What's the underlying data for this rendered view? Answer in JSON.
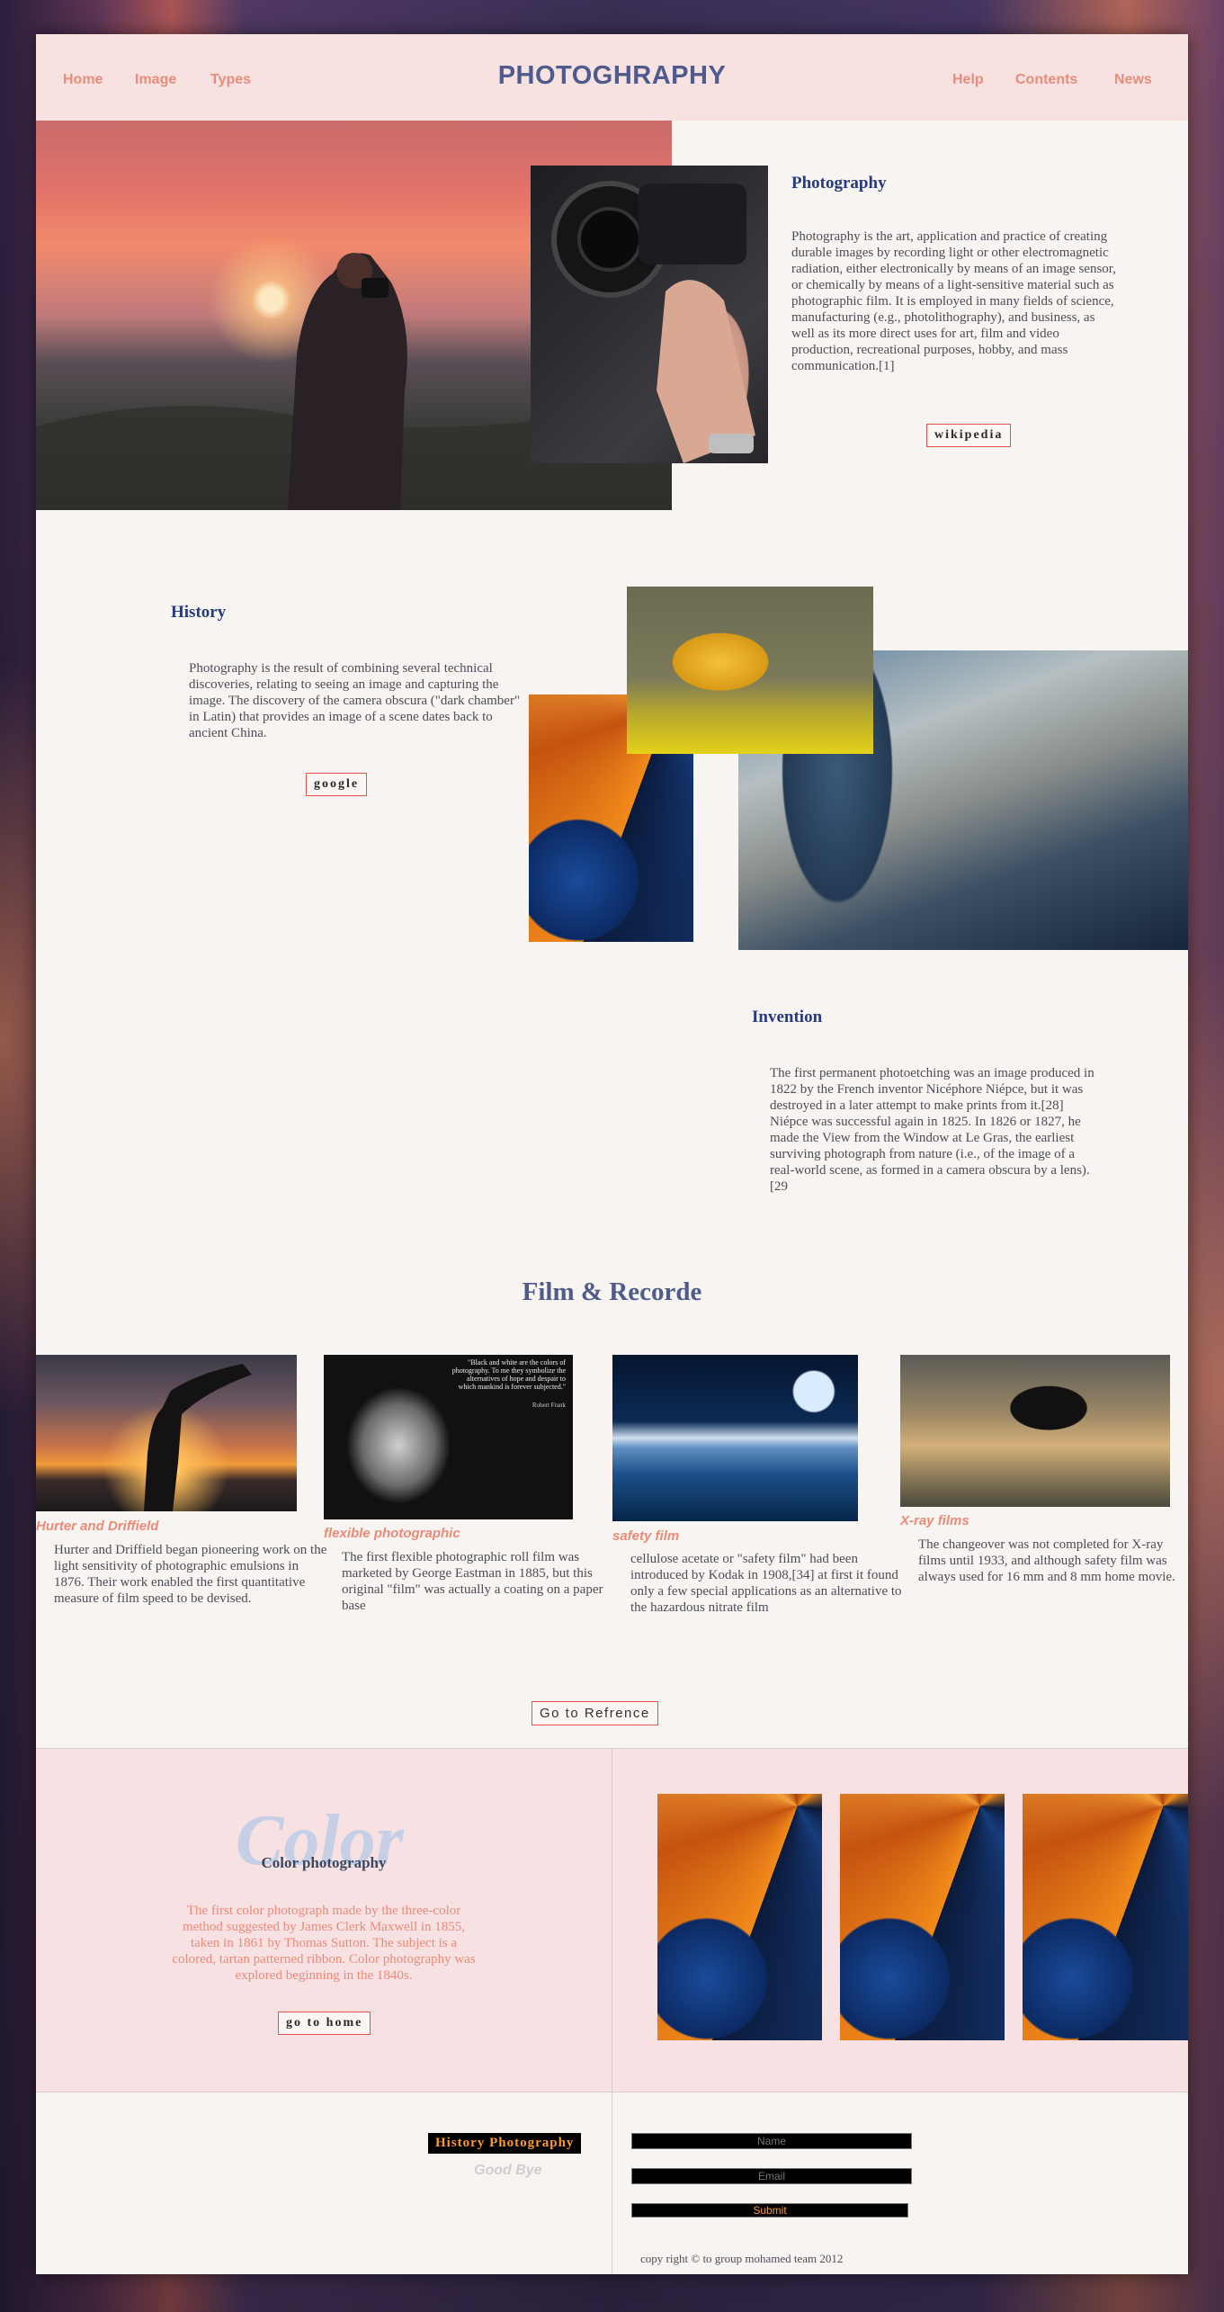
{
  "nav": {
    "left": [
      "Home",
      "Image",
      "Types"
    ],
    "brand": "PHOTOGHRAPHY",
    "right": [
      "Help",
      "Contents",
      "News"
    ]
  },
  "photography": {
    "title": "Photography",
    "text": "Photography is the art, application and practice of creating durable images by recording light or other electromagnetic radiation, either electronically by means of an image sensor, or chemically by means of a light-sensitive material such as photographic film. It is employed in many fields of science, manufacturing (e.g., photolithography), and business, as well as its more direct uses for art, film and video production, recreational purposes, hobby, and mass communication.[1]",
    "button": "wikipedia"
  },
  "history": {
    "title": "History",
    "text": "Photography is the result of combining several technical discoveries, relating to seeing an image and capturing the image. The discovery of the camera obscura (\"dark chamber\" in Latin) that provides an image of a scene dates back to ancient China.",
    "button": "google"
  },
  "invention": {
    "title": "Invention",
    "text": "The first permanent photoetching was an image produced in 1822 by the French inventor Nicéphore Niépce, but it was destroyed in a later attempt to make prints from it.[28] Niépce was successful again in 1825. In 1826 or 1827, he made the View from the Window at Le Gras, the earliest surviving photograph from nature (i.e., of the image of a real-world scene, as formed in a camera obscura by a lens).[29"
  },
  "film": {
    "heading": "Film & Recorde",
    "cards": [
      {
        "title": "Hurter and Driffield",
        "text": "Hurter and Driffield began pioneering work on the light sensitivity of photographic emulsions in 1876. Their work enabled the first quantitative measure of film speed to be devised."
      },
      {
        "title": "flexible photographic",
        "text": "The first flexible photographic roll film was marketed by George Eastman in 1885, but this original \"film\" was actually a coating on a paper base"
      },
      {
        "title": "safety film",
        "text": "cellulose acetate or \"safety film\" had been introduced by Kodak in 1908,[34] at first it found only a few special applications as an alternative to the hazardous nitrate film"
      },
      {
        "title": "X-ray films",
        "text": "The changeover was not completed for X-ray films until 1933, and although safety film was always used for 16 mm and 8 mm home movie."
      }
    ],
    "bw_quote": "\"Black and white are the colors of photography. To me they symbolize the alternatives of hope and despair to which mankind is forever subjected.\"",
    "bw_author": "Robert Frank",
    "button": "Go to Refrence"
  },
  "color": {
    "big_word": "Color",
    "title": "Color photography",
    "text": "The first color photograph made by the three-color method suggested by James Clerk Maxwell in 1855, taken in 1861 by Thomas Sutton. The subject is a colored, tartan patterned ribbon. Color photography was explored beginning in the 1840s.",
    "button": "go to home"
  },
  "footer": {
    "badge": "History Photography",
    "goodbye": "Good Bye",
    "name_placeholder": "Name",
    "email_placeholder": "Email",
    "submit": "Submit",
    "copyright": "copy right © to group mohamed team 2012"
  }
}
